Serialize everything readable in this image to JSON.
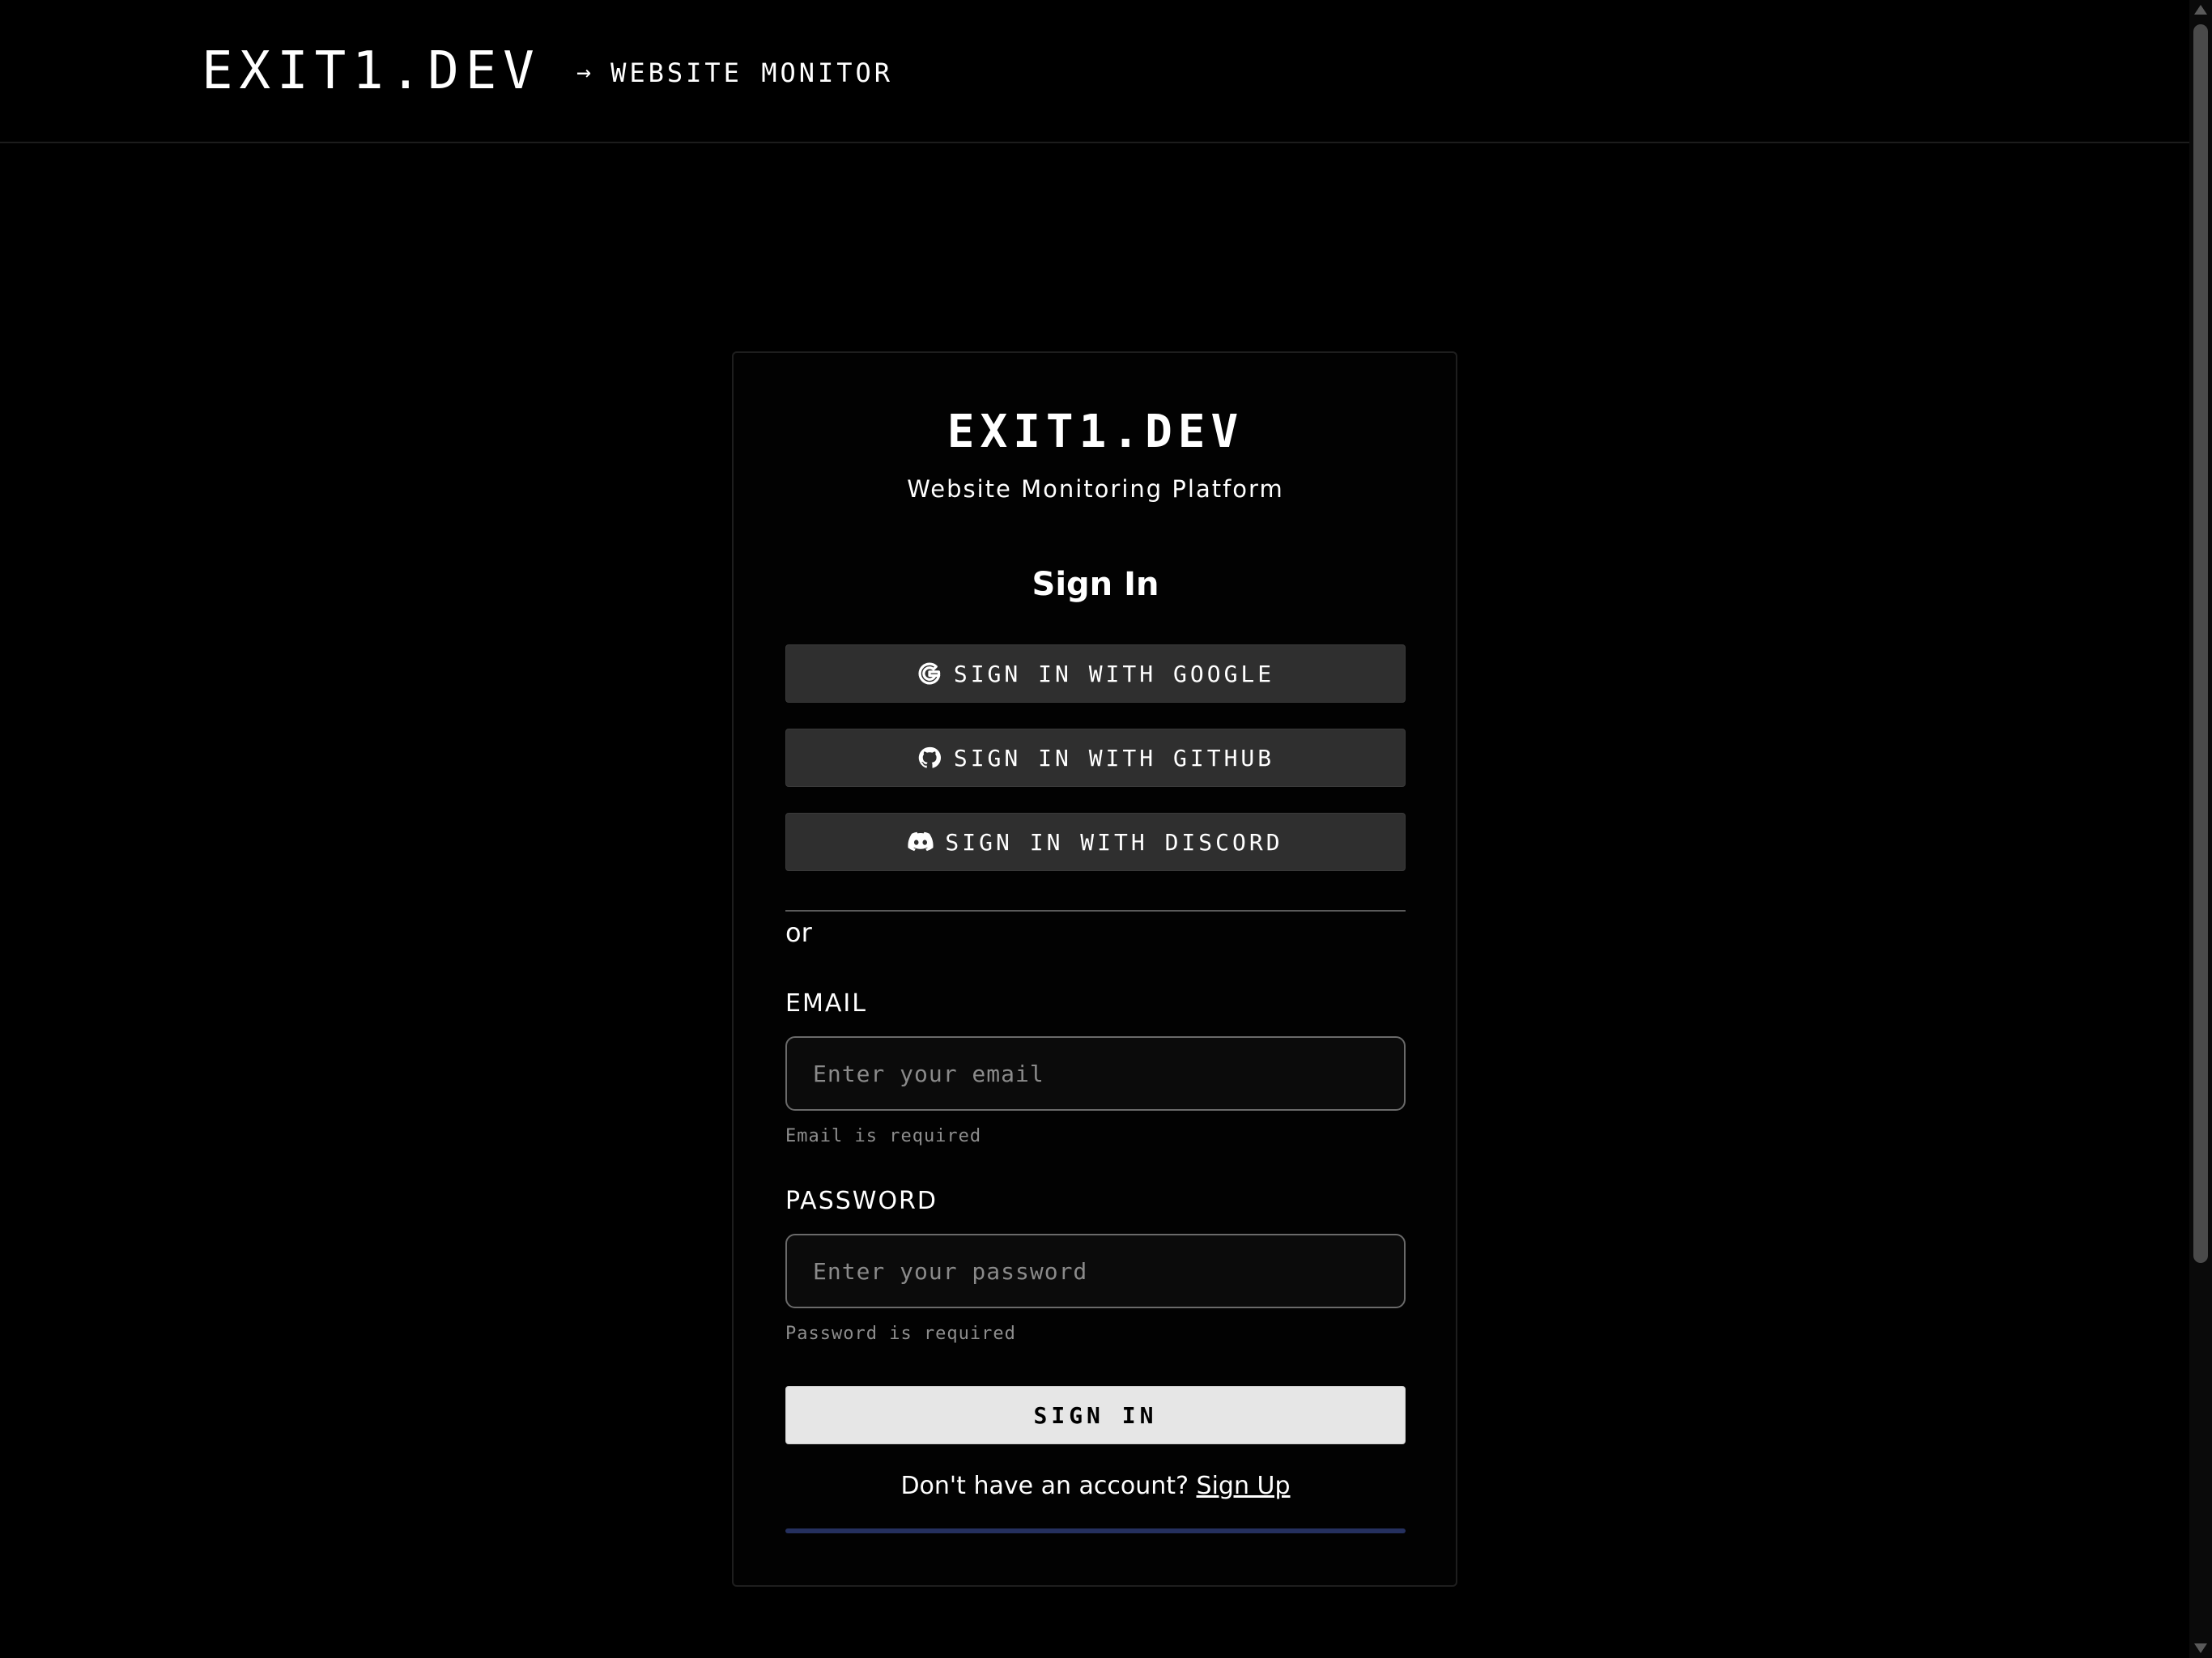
{
  "header": {
    "brand": "EXIT1.DEV",
    "subnav_arrow": "→",
    "subnav_label": "WEBSITE MONITOR"
  },
  "card": {
    "title": "EXIT1.DEV",
    "subtitle": "Website Monitoring Platform",
    "heading": "Sign In",
    "oauth": {
      "google": {
        "label": "SIGN IN WITH GOOGLE",
        "icon": "google-icon"
      },
      "github": {
        "label": "SIGN IN WITH GITHUB",
        "icon": "github-icon"
      },
      "discord": {
        "label": "SIGN IN WITH DISCORD",
        "icon": "discord-icon"
      }
    },
    "divider_text": "or",
    "email": {
      "label": "EMAIL",
      "value": "",
      "placeholder": "Enter your email",
      "error": "Email is required"
    },
    "password": {
      "label": "PASSWORD",
      "value": "",
      "placeholder": "Enter your password",
      "error": "Password is required"
    },
    "submit_label": "SIGN IN",
    "signup_prompt": "Don't have an account?",
    "signup_link": "Sign Up",
    "progress": 1.0
  },
  "colors": {
    "background": "#000000",
    "oauth_button": "#2f2f2f",
    "submit_button": "#e6e6e6",
    "progress_bar": "#25305e"
  }
}
